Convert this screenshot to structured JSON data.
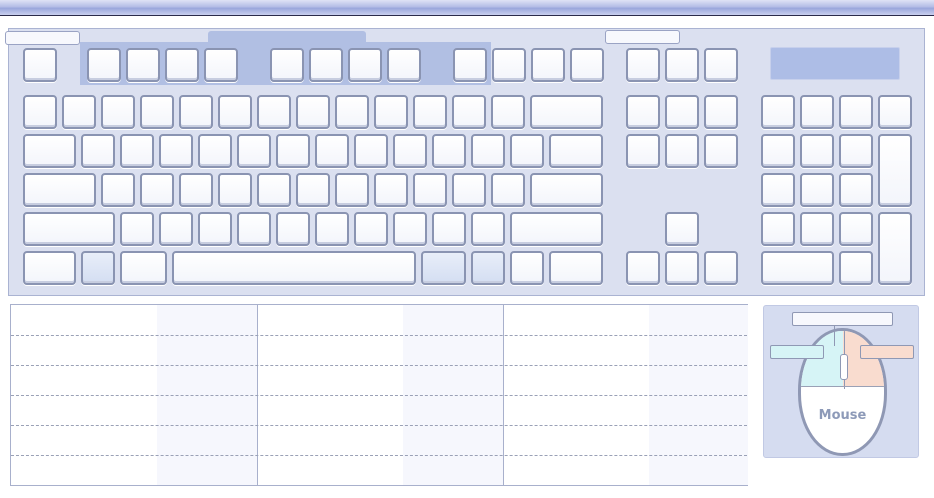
{
  "window": {
    "title": ""
  },
  "keyboard": {
    "section_labels": [
      "",
      "",
      ""
    ],
    "display_text": ""
  },
  "mapping_table": {
    "columns": 6,
    "rows": [
      [
        "",
        "",
        "",
        "",
        "",
        ""
      ],
      [
        "",
        "",
        "",
        "",
        "",
        ""
      ],
      [
        "",
        "",
        "",
        "",
        "",
        ""
      ],
      [
        "",
        "",
        "",
        "",
        "",
        ""
      ],
      [
        "",
        "",
        "",
        "",
        "",
        ""
      ],
      [
        "",
        "",
        "",
        "",
        "",
        ""
      ]
    ]
  },
  "mouse": {
    "title": "Mouse",
    "top_label": "",
    "left_button_label": "",
    "right_button_label": ""
  },
  "colors": {
    "keyboard_bg": "#dbe0f0",
    "highlight_region": "#b1bfe3",
    "left_button": "#d6f4f6",
    "right_button": "#f9dccf"
  }
}
